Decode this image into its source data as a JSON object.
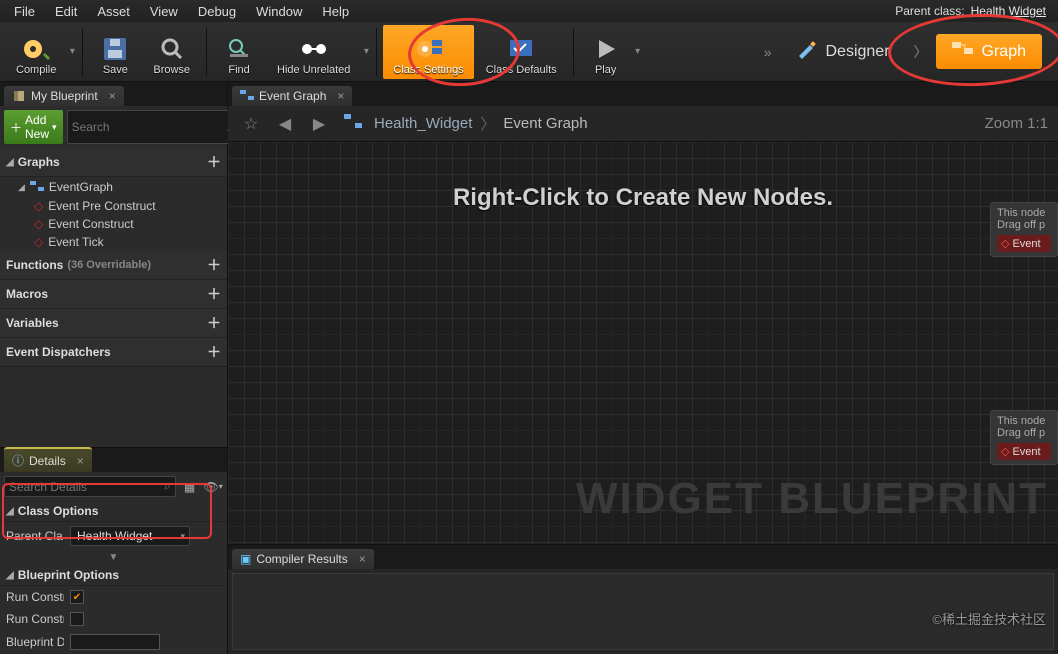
{
  "menu": {
    "items": [
      "File",
      "Edit",
      "Asset",
      "View",
      "Debug",
      "Window",
      "Help"
    ]
  },
  "parent_label": "Parent class:",
  "parent_value": "Health Widget",
  "toolbar": {
    "compile": "Compile",
    "save": "Save",
    "browse": "Browse",
    "find": "Find",
    "hide": "Hide Unrelated",
    "class_settings": "Class Settings",
    "class_defaults": "Class Defaults",
    "play": "Play"
  },
  "modes": {
    "designer": "Designer",
    "graph": "Graph"
  },
  "myblueprint": {
    "title": "My Blueprint",
    "add_new": "Add New",
    "search_ph": "Search",
    "cats": {
      "graphs": "Graphs",
      "functions": "Functions",
      "functions_meta": "(36 Overridable)",
      "macros": "Macros",
      "variables": "Variables",
      "dispatchers": "Event Dispatchers"
    },
    "graph_root": "EventGraph",
    "events": [
      "Event Pre Construct",
      "Event Construct",
      "Event Tick"
    ]
  },
  "details": {
    "title": "Details",
    "search_ph": "Search Details",
    "class_options": "Class Options",
    "parent_class_lbl": "Parent Cla",
    "parent_class_val": "Health Widget",
    "blueprint_options": "Blueprint Options",
    "run_constr": "Run Constr",
    "blueprint_d": "Blueprint D"
  },
  "graphtab": {
    "title": "Event Graph"
  },
  "breadcrumb": {
    "a": "Health_Widget",
    "b": "Event Graph"
  },
  "zoom": "Zoom 1:1",
  "hint": "Right-Click to Create New Nodes.",
  "watermark": "WIDGET BLUEPRINT",
  "stub": {
    "l1": "This node",
    "l2": "Drag off p",
    "ev": "Event"
  },
  "compiler": {
    "title": "Compiler Results"
  },
  "corner_wm": "©稀土掘金技术社区"
}
